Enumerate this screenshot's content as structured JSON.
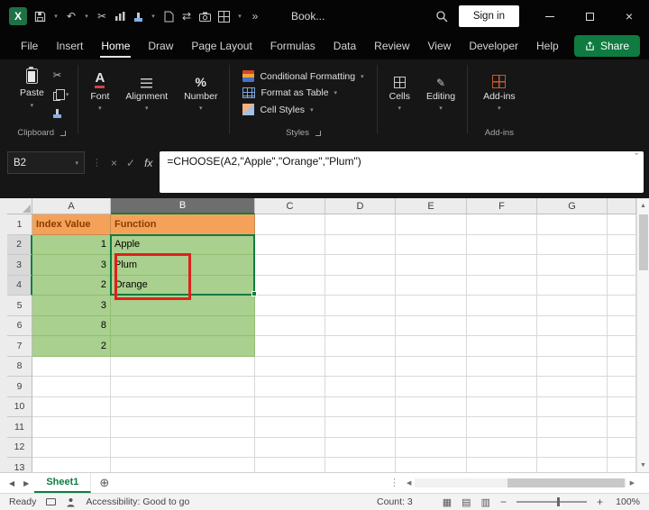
{
  "titlebar": {
    "title": "Book...",
    "sign_in": "Sign in"
  },
  "menubar": {
    "tabs": [
      "File",
      "Insert",
      "Home",
      "Draw",
      "Page Layout",
      "Formulas",
      "Data",
      "Review",
      "View",
      "Developer",
      "Help"
    ],
    "active_tab": "Home",
    "share_label": "Share"
  },
  "ribbon": {
    "paste_label": "Paste",
    "clipboard_group_label": "Clipboard",
    "font_label": "Font",
    "alignment_label": "Alignment",
    "number_label": "Number",
    "styles": {
      "items": [
        "Conditional Formatting",
        "Format as Table",
        "Cell Styles"
      ],
      "group_label": "Styles"
    },
    "cells_label": "Cells",
    "editing_label": "Editing",
    "addins_label": "Add-ins",
    "addins_group_label": "Add-ins"
  },
  "formula_bar": {
    "name_box": "B2",
    "fx_label": "fx",
    "formula": "=CHOOSE(A2,\"Apple\",\"Orange\",\"Plum\")"
  },
  "grid": {
    "column_headers": [
      "A",
      "B",
      "C",
      "D",
      "E",
      "F",
      "G",
      ""
    ],
    "row_headers": [
      "1",
      "2",
      "3",
      "4",
      "5",
      "6",
      "7",
      "8",
      "9",
      "10",
      "11",
      "12",
      "13"
    ],
    "selected_column": "B",
    "selected_rows": [
      "2",
      "3",
      "4"
    ],
    "selection_range": "B2:B4",
    "cells": {
      "A1": {
        "v": "Index Value",
        "fill": "orange"
      },
      "B1": {
        "v": "Function",
        "fill": "orange"
      },
      "A2": {
        "v": "1",
        "fill": "green",
        "align": "right"
      },
      "B2": {
        "v": "Apple",
        "fill": "green"
      },
      "A3": {
        "v": "3",
        "fill": "green",
        "align": "right"
      },
      "B3": {
        "v": "Plum",
        "fill": "green"
      },
      "A4": {
        "v": "2",
        "fill": "green",
        "align": "right"
      },
      "B4": {
        "v": "Orange",
        "fill": "green"
      },
      "A5": {
        "v": "3",
        "fill": "green",
        "align": "right"
      },
      "B5": {
        "v": "",
        "fill": "green"
      },
      "A6": {
        "v": "8",
        "fill": "green",
        "align": "right"
      },
      "B6": {
        "v": "",
        "fill": "green"
      },
      "A7": {
        "v": "2",
        "fill": "green",
        "align": "right"
      },
      "B7": {
        "v": "",
        "fill": "green"
      }
    }
  },
  "sheet_tabs": [
    "Sheet1"
  ],
  "status_bar": {
    "mode": "Ready",
    "accessibility": "Accessibility: Good to go",
    "count": "Count: 3",
    "zoom": "100%"
  },
  "icons": {
    "chevron_down": "▾",
    "undo": "↶",
    "cut": "✂",
    "switch_windows": "⇄",
    "overflow": "»",
    "vertical_dots": "⋮",
    "cancel": "×",
    "confirm": "✓",
    "close": "×",
    "scroll_up": "▲",
    "scroll_down": "▼",
    "scroll_left": "◀",
    "scroll_right": "▶",
    "add_sheet": "⊕",
    "view_normal": "▦",
    "view_page_layout": "▤",
    "view_page_break": "▥",
    "zoom_out": "−",
    "zoom_in": "+",
    "edit_pencil": "✎",
    "font_letter": "A",
    "percent": "%",
    "expand": "ˇ"
  },
  "colors": {
    "accent_green": "#21A366",
    "selection_green": "#107C41",
    "share_green": "#0F7B41",
    "orange_fill": "#F4A259",
    "orange_text": "#8A3B00",
    "green_fill": "#A9D08E",
    "annotation_red": "#E0201B"
  }
}
